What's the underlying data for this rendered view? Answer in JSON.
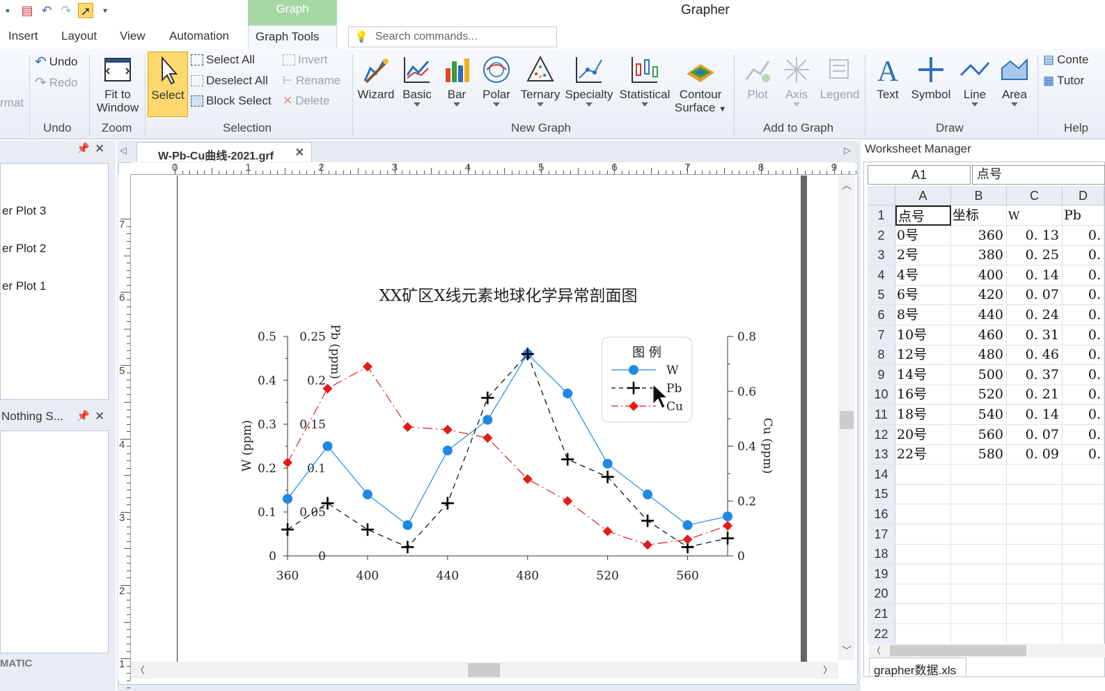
{
  "window": {
    "title": "Grapher",
    "context_tab": "Graph"
  },
  "menu": {
    "insert": "Insert",
    "layout": "Layout",
    "view": "View",
    "automation": "Automation",
    "graph_tools": "Graph Tools"
  },
  "search": {
    "placeholder": "Search commands..."
  },
  "ribbon": {
    "format_label": "rmat",
    "undo": "Undo",
    "redo": "Redo",
    "undo_group": "Undo",
    "fit_to": "Fit to",
    "window": "Window",
    "zoom_group": "Zoom",
    "select": "Select",
    "select_all": "Select All",
    "deselect_all": "Deselect All",
    "block_select": "Block Select",
    "invert": "Invert",
    "rename": "Rename",
    "delete": "Delete",
    "selection_group": "Selection",
    "wizard": "Wizard",
    "basic": "Basic",
    "bar": "Bar",
    "polar": "Polar",
    "ternary": "Ternary",
    "specialty": "Specialty",
    "statistical": "Statistical",
    "contour": "Contour",
    "surface": "Surface",
    "new_graph_group": "New Graph",
    "plot": "Plot",
    "axis": "Axis",
    "legend": "Legend",
    "add_to_graph_group": "Add to Graph",
    "text": "Text",
    "symbol": "Symbol",
    "line": "Line",
    "area": "Area",
    "draw_group": "Draw",
    "contents": "Conte",
    "tutorial": "Tutor",
    "help_group": "Help"
  },
  "left_panel": {
    "items": [
      "er Plot 3",
      "er Plot 2",
      "er Plot 1"
    ],
    "lower_title": "Nothing S...",
    "footer": "MATIC"
  },
  "document": {
    "tab": "W-Pb-Cu曲线-2021.grf"
  },
  "ruler": {
    "top": [
      "0",
      "1",
      "2",
      "3",
      "4",
      "5",
      "6",
      "7",
      "8",
      "9"
    ],
    "left": [
      "7",
      "6",
      "5",
      "4",
      "3",
      "2",
      "1"
    ]
  },
  "chart_data": {
    "type": "line",
    "title": "XX矿区X线元素地球化学异常剖面图",
    "x": [
      360,
      380,
      400,
      420,
      440,
      460,
      480,
      500,
      520,
      540,
      560,
      580
    ],
    "xlim": [
      360,
      580
    ],
    "xticks": [
      "360",
      "400",
      "440",
      "480",
      "520",
      "560"
    ],
    "series": [
      {
        "name": "W",
        "axis": "W (ppm)",
        "values": [
          0.13,
          0.25,
          0.14,
          0.07,
          0.24,
          0.31,
          0.46,
          0.37,
          0.21,
          0.14,
          0.07,
          0.09
        ],
        "color": "#1e88e5"
      },
      {
        "name": "Pb",
        "axis": "Pb (ppm)",
        "values": [
          0.06,
          0.12,
          0.06,
          0.02,
          0.12,
          0.36,
          0.46,
          0.22,
          0.18,
          0.08,
          0.02,
          0.04
        ],
        "color": "#000000"
      },
      {
        "name": "Cu",
        "axis": "Cu (ppm)",
        "values": [
          0.34,
          0.61,
          0.69,
          0.47,
          0.46,
          0.43,
          0.28,
          0.2,
          0.09,
          0.04,
          0.06,
          0.11
        ],
        "color": "#e31b1b"
      }
    ],
    "axes": {
      "w": {
        "label": "W (ppm)",
        "ticks": [
          "0",
          "0.1",
          "0.2",
          "0.3",
          "0.4",
          "0.5"
        ],
        "lim": [
          0,
          0.5
        ]
      },
      "pb": {
        "label": "Pb (ppm)",
        "ticks": [
          "0",
          "0.05",
          "0.1",
          "0.15",
          "0.2",
          "0.25"
        ],
        "lim": [
          0,
          0.25
        ]
      },
      "cu": {
        "label": "Cu (ppm)",
        "ticks": [
          "0",
          "0.2",
          "0.4",
          "0.6",
          "0.8"
        ],
        "lim": [
          0,
          0.8
        ]
      }
    },
    "legend_title": "图 例",
    "legend_position": "top-right"
  },
  "worksheet": {
    "title": "Worksheet Manager",
    "cell_ref": "A1",
    "cell_value": "点号",
    "columns": [
      "A",
      "B",
      "C",
      "D"
    ],
    "rows": [
      [
        "点号",
        "坐标",
        "W",
        "Pb"
      ],
      [
        "0号",
        "360",
        "0. 13",
        "0."
      ],
      [
        "2号",
        "380",
        "0. 25",
        "0."
      ],
      [
        "4号",
        "400",
        "0. 14",
        "0."
      ],
      [
        "6号",
        "420",
        "0. 07",
        "0."
      ],
      [
        "8号",
        "440",
        "0. 24",
        "0."
      ],
      [
        "10号",
        "460",
        "0. 31",
        "0."
      ],
      [
        "12号",
        "480",
        "0. 46",
        "0."
      ],
      [
        "14号",
        "500",
        "0. 37",
        "0."
      ],
      [
        "16号",
        "520",
        "0. 21",
        "0."
      ],
      [
        "18号",
        "540",
        "0. 14",
        "0."
      ],
      [
        "20号",
        "560",
        "0. 07",
        "0."
      ],
      [
        "22号",
        "580",
        "0. 09",
        "0."
      ]
    ],
    "row_numbers": [
      "1",
      "2",
      "3",
      "4",
      "5",
      "6",
      "7",
      "8",
      "9",
      "10",
      "11",
      "12",
      "13",
      "14",
      "15",
      "16",
      "17",
      "18",
      "19",
      "20",
      "21",
      "22"
    ],
    "sheet_tab": "grapher数据.xls"
  }
}
